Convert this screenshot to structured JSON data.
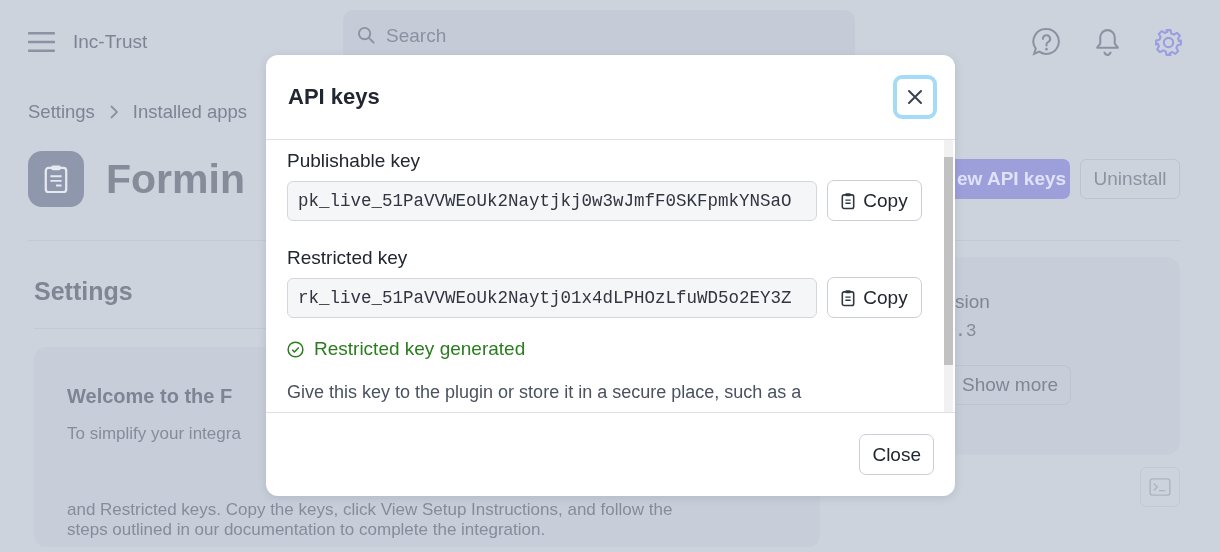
{
  "header": {
    "brand": "Inc-Trust",
    "search": {
      "placeholder": "Search"
    }
  },
  "breadcrumb": [
    {
      "label": "Settings"
    },
    {
      "label": "Installed apps"
    }
  ],
  "app": {
    "title": "Formin",
    "actions": [
      {
        "label": "ew API keys",
        "kind": "primary"
      },
      {
        "label": "Uninstall",
        "kind": "secondary"
      }
    ]
  },
  "settings": {
    "title": "Settings",
    "welcome": {
      "title": "Welcome to the F",
      "lines": [
        "To simplify your integra",
        "and Restricted keys. Copy the keys, click View Setup Instructions, and follow the",
        "steps outlined in our documentation to complete the integration."
      ]
    }
  },
  "version_card": {
    "label": "sion",
    "value": ".3",
    "button": "Show more"
  },
  "modal": {
    "title": "API keys",
    "fields": [
      {
        "label": "Publishable key",
        "value": "pk_live_51PaVVWEoUk2Naytjkj0w3wJmfF0SKFpmkYNSaO",
        "button": "Copy"
      },
      {
        "label": "Restricted key",
        "value": "rk_live_51PaVVWEoUk2Naytj01x4dLPHOzLfuWD5o2EY3Z",
        "button": "Copy"
      }
    ],
    "status": {
      "text": "Restricted key generated"
    },
    "note": "Give this key to the plugin or store it in a secure place, such as a",
    "close_button": "Close"
  }
}
